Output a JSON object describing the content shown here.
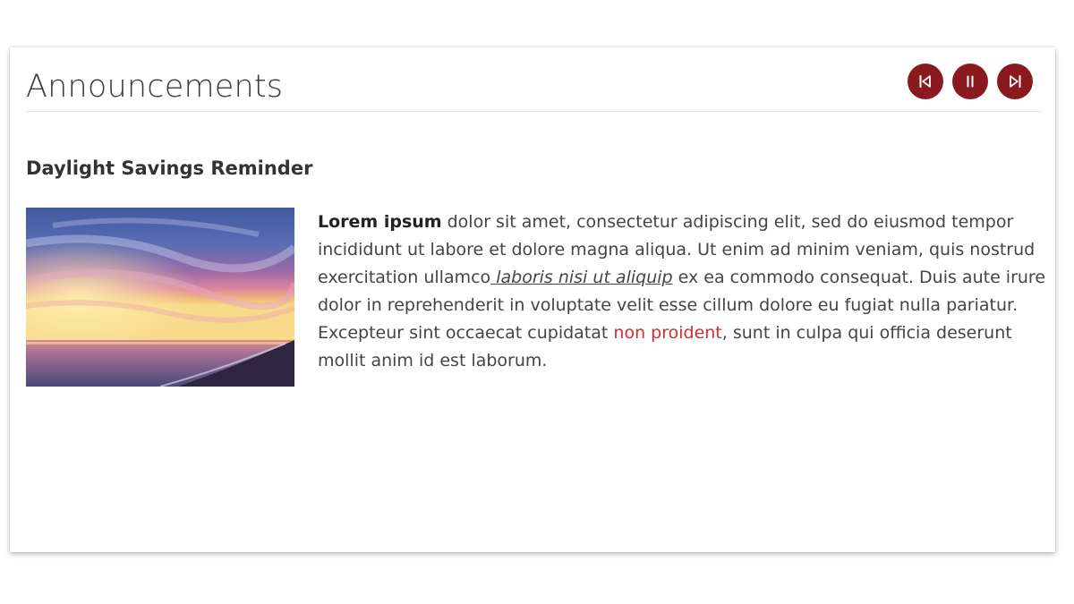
{
  "widget": {
    "title": "Announcements",
    "controls": {
      "previous_icon": "skip-previous-icon",
      "pause_icon": "pause-icon",
      "next_icon": "skip-next-icon",
      "button_color": "#8b1a1f",
      "icon_color": "#ffffff"
    }
  },
  "announcement": {
    "headline": "Daylight Savings Reminder",
    "image": "sunset-over-ocean",
    "body": {
      "lead": "Lorem ipsum",
      "text_1": " dolor sit amet, consectetur adipiscing elit, sed do eiusmod tempor incididunt ut labore et dolore magna aliqua. Ut enim ad minim veniam, quis nostrud exercitation ullamco",
      "link": " laboris nisi ut aliquip",
      "text_2": " ex ea commodo consequat. Duis aute irure dolor in reprehenderit in voluptate velit esse cillum dolore eu fugiat nulla pariatur. Excepteur sint occaecat cupidatat ",
      "highlight": "non proident",
      "text_3": ", sunt in culpa qui officia deserunt mollit anim id est laborum.",
      "highlight_color": "#d32f2f"
    }
  }
}
